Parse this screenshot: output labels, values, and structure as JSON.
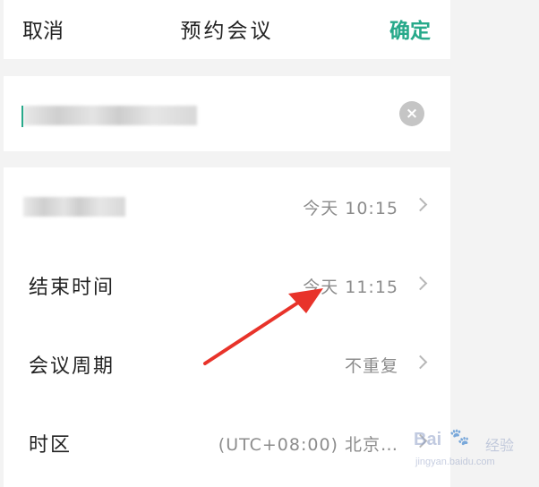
{
  "header": {
    "cancel_label": "取消",
    "title": "预约会议",
    "confirm_label": "确定",
    "confirm_color": "#27a98a"
  },
  "title_input": {
    "clear_icon": "×"
  },
  "rows": [
    {
      "label": "",
      "value": "今天 10:15"
    },
    {
      "label": "结束时间",
      "value": "今天 11:15"
    },
    {
      "label": "会议周期",
      "value": "不重复"
    },
    {
      "label": "时区",
      "value": "(UTC+08:00) 北京…"
    }
  ],
  "annotation": {
    "arrow_color": "#e8332a"
  },
  "watermark": {
    "brand": "Bai",
    "paw": "🐾",
    "sub": "经验",
    "url": "jingyan.baidu.com"
  }
}
